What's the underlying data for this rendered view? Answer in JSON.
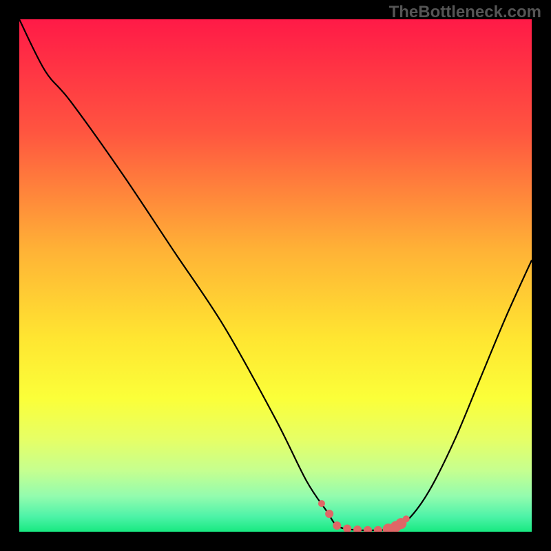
{
  "watermark": "TheBottleneck.com",
  "chart_data": {
    "type": "line",
    "title": "",
    "xlabel": "",
    "ylabel": "",
    "xlim": [
      0,
      100
    ],
    "ylim": [
      0,
      100
    ],
    "gradient_stops": [
      {
        "offset": 0,
        "color": "#ff1a47"
      },
      {
        "offset": 22,
        "color": "#ff5540"
      },
      {
        "offset": 45,
        "color": "#ffb236"
      },
      {
        "offset": 62,
        "color": "#ffe531"
      },
      {
        "offset": 74,
        "color": "#fbff39"
      },
      {
        "offset": 82,
        "color": "#e6ff66"
      },
      {
        "offset": 88,
        "color": "#c6ff8f"
      },
      {
        "offset": 93,
        "color": "#94fcae"
      },
      {
        "offset": 97,
        "color": "#4ef3a8"
      },
      {
        "offset": 100,
        "color": "#18e981"
      }
    ],
    "series": [
      {
        "name": "bottleneck-curve",
        "points": [
          {
            "x": 0,
            "y": 100
          },
          {
            "x": 5,
            "y": 90
          },
          {
            "x": 10,
            "y": 84
          },
          {
            "x": 20,
            "y": 70
          },
          {
            "x": 30,
            "y": 55
          },
          {
            "x": 40,
            "y": 40
          },
          {
            "x": 50,
            "y": 22
          },
          {
            "x": 56,
            "y": 10
          },
          {
            "x": 60,
            "y": 4
          },
          {
            "x": 62,
            "y": 1.2
          },
          {
            "x": 65,
            "y": 0.4
          },
          {
            "x": 70,
            "y": 0.3
          },
          {
            "x": 73,
            "y": 0.7
          },
          {
            "x": 76,
            "y": 2.5
          },
          {
            "x": 80,
            "y": 8
          },
          {
            "x": 85,
            "y": 18
          },
          {
            "x": 90,
            "y": 30
          },
          {
            "x": 95,
            "y": 42
          },
          {
            "x": 100,
            "y": 53
          }
        ]
      },
      {
        "name": "highlight-dots",
        "points": [
          {
            "x": 59,
            "y": 5.5
          },
          {
            "x": 60.5,
            "y": 3.5
          },
          {
            "x": 62,
            "y": 1.2
          },
          {
            "x": 64,
            "y": 0.6
          },
          {
            "x": 66,
            "y": 0.4
          },
          {
            "x": 68,
            "y": 0.3
          },
          {
            "x": 70,
            "y": 0.3
          },
          {
            "x": 72,
            "y": 0.5
          },
          {
            "x": 73.5,
            "y": 1.0
          },
          {
            "x": 74.5,
            "y": 1.6
          },
          {
            "x": 75.5,
            "y": 2.5
          }
        ]
      }
    ]
  }
}
